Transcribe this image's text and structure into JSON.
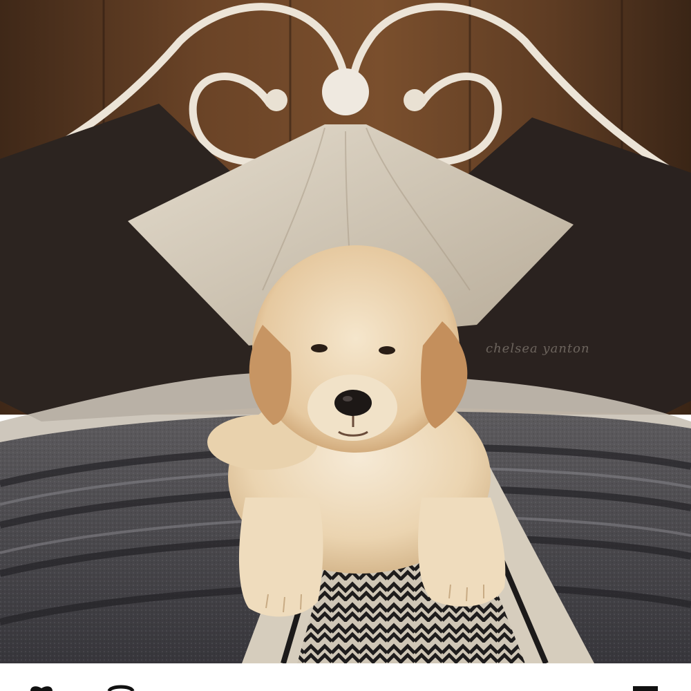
{
  "photo": {
    "subject": "golden-retriever-puppy-on-bed",
    "watermark": "chelsea yanton"
  },
  "colors": {
    "wall": "#5a3a22",
    "headboard": "#ede6da",
    "pillow_dark": "#2e2521",
    "pillow_light": "#d9cfbf",
    "puppy_fur": "#ecd6b2",
    "blanket": "#4a4a4f"
  },
  "action_bar": {
    "icons": [
      "heart-icon",
      "comment-icon",
      "bookmark-icon"
    ]
  }
}
